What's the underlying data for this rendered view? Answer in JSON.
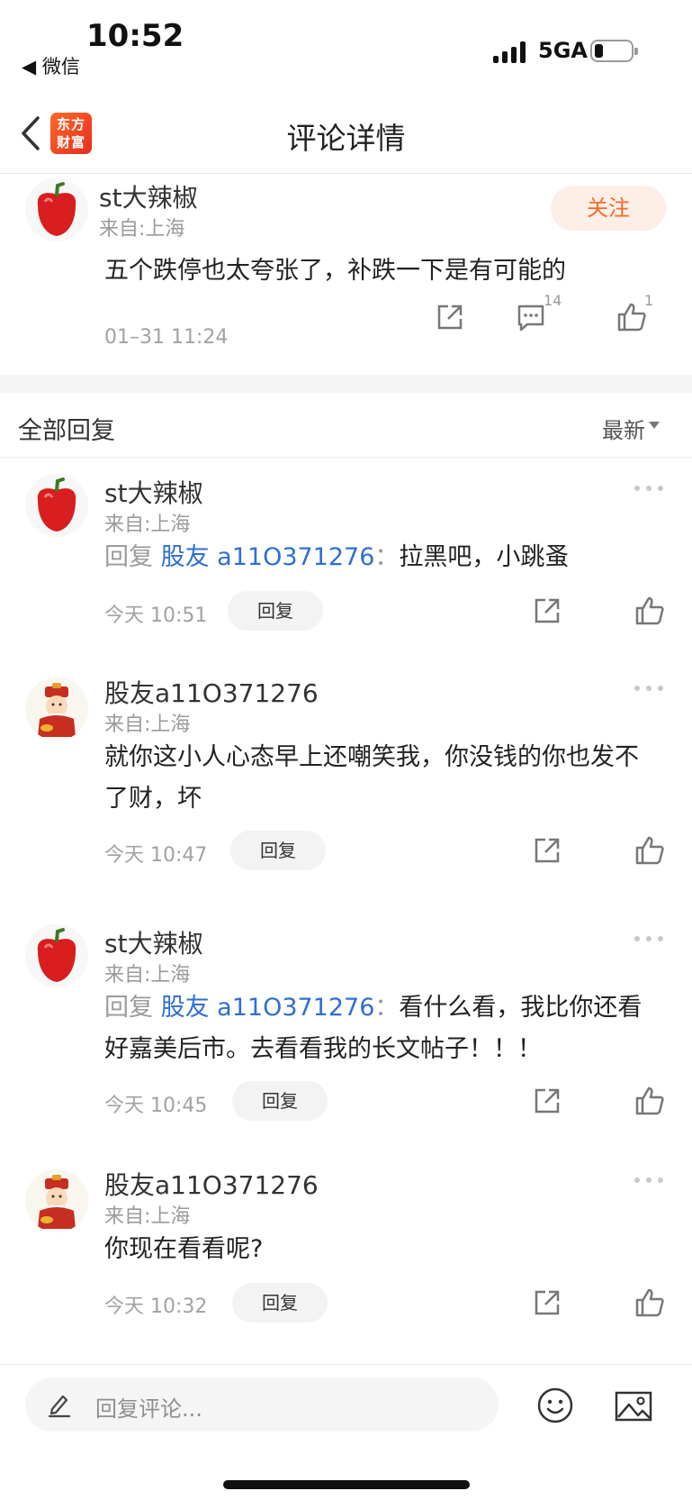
{
  "status_bar": {
    "time": "10:52",
    "back_app": "◀ 微信",
    "network": "5GA"
  },
  "nav": {
    "title": "评论详情",
    "logo_text_line1": "东方",
    "logo_text_line2": "财富"
  },
  "main_comment": {
    "user": "st大辣椒",
    "location": "来自:上海",
    "follow_label": "关注",
    "text": "五个跌停也太夸张了，补跌一下是有可能的",
    "time": "01–31 11:24",
    "comment_count": "14",
    "like_count": "1"
  },
  "replies_header": {
    "title": "全部回复",
    "sort": "最新"
  },
  "replies": [
    {
      "user": "st大辣椒",
      "location": "来自:上海",
      "prefix": "回复 ",
      "mention": "股友 a11O371276",
      "sep": "：",
      "text": "拉黑吧，小跳蚤",
      "time": "今天 10:51",
      "reply_label": "回复"
    },
    {
      "user": "股友a11O371276",
      "location": "来自:上海",
      "prefix": "",
      "mention": "",
      "sep": "",
      "text": "就你这小人心态早上还嘲笑我，你没钱的你也发不了财，坏",
      "time": "今天 10:47",
      "reply_label": "回复"
    },
    {
      "user": "st大辣椒",
      "location": "来自:上海",
      "prefix": "回复 ",
      "mention": "股友 a11O371276",
      "sep": "：",
      "text": "看什么看，我比你还看好嘉美后市。去看看我的长文帖子！！！",
      "time": "今天 10:45",
      "reply_label": "回复"
    },
    {
      "user": "股友a11O371276",
      "location": "来自:上海",
      "prefix": "",
      "mention": "",
      "sep": "",
      "text": "你现在看看呢?",
      "time": "今天 10:32",
      "reply_label": "回复"
    }
  ],
  "bottom_bar": {
    "placeholder": "回复评论..."
  },
  "colors": {
    "accent": "#f06b2c",
    "link": "#2f6fd1",
    "muted": "#9a9a9a"
  }
}
